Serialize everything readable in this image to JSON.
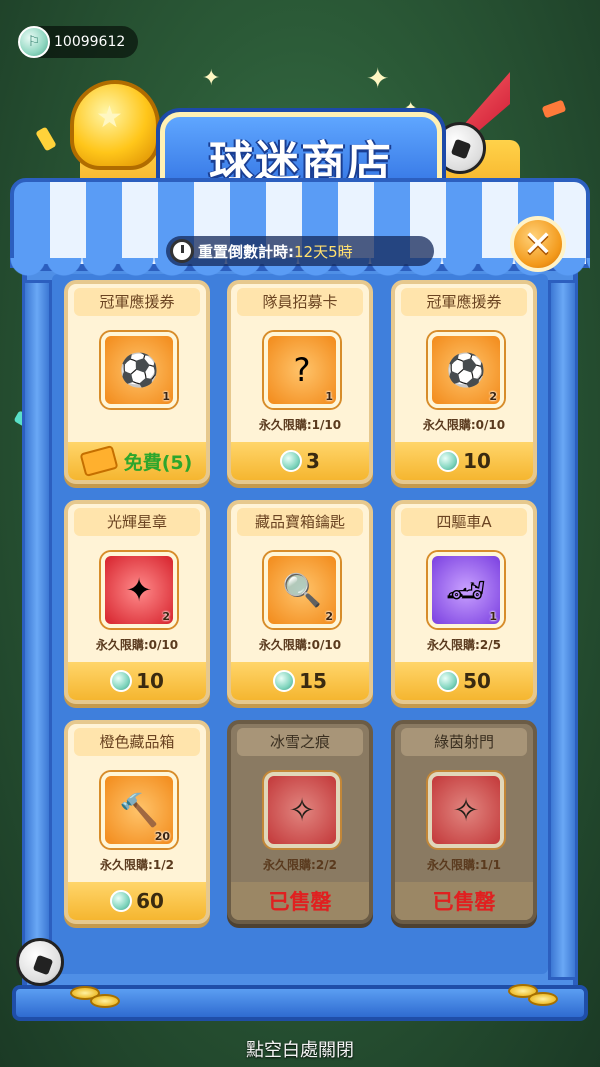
{
  "currency": {
    "amount": "10099612",
    "icon": "gem-coin-icon"
  },
  "title": "球迷商店",
  "timer": {
    "label": "重置倒數計時:",
    "value": "12天5時"
  },
  "close_glyph": "✕",
  "hint": "點空白處關閉",
  "items": [
    {
      "name": "冠軍應援券",
      "icon": "ticket-card-icon",
      "glyph": "⚽",
      "frame": "orange",
      "count": "1",
      "limit": "",
      "price": "免費(5)",
      "price_type": "free"
    },
    {
      "name": "隊員招募卡",
      "icon": "recruit-card-icon",
      "glyph": "?",
      "frame": "orange",
      "count": "1",
      "limit": "永久限購:1/10",
      "price": "3",
      "price_type": "gem"
    },
    {
      "name": "冠軍應援券",
      "icon": "ticket-card-icon",
      "glyph": "⚽",
      "frame": "orange",
      "count": "2",
      "limit": "永久限購:0/10",
      "price": "10",
      "price_type": "gem"
    },
    {
      "name": "光輝星章",
      "icon": "star-badge-icon",
      "glyph": "✦",
      "frame": "red",
      "count": "2",
      "limit": "永久限購:0/10",
      "price": "10",
      "price_type": "gem"
    },
    {
      "name": "藏品寶箱鑰匙",
      "icon": "magnifier-key-icon",
      "glyph": "🔍",
      "frame": "orange",
      "count": "2",
      "limit": "永久限購:0/10",
      "price": "15",
      "price_type": "gem"
    },
    {
      "name": "四驅車A",
      "icon": "race-car-icon",
      "glyph": "🏎",
      "frame": "purple",
      "count": "1",
      "limit": "永久限購:2/5",
      "price": "50",
      "price_type": "gem"
    },
    {
      "name": "橙色藏品箱",
      "icon": "collection-box-icon",
      "glyph": "🔨",
      "frame": "orange",
      "count": "20",
      "limit": "永久限購:1/2",
      "price": "60",
      "price_type": "gem"
    },
    {
      "name": "冰雪之痕",
      "icon": "ice-gun-icon",
      "glyph": "✧",
      "frame": "red",
      "count": "",
      "limit": "永久限購:2/2",
      "price": "已售罄",
      "price_type": "soldout"
    },
    {
      "name": "綠茵射門",
      "icon": "green-gun-icon",
      "glyph": "✧",
      "frame": "red",
      "count": "",
      "limit": "永久限購:1/1",
      "price": "已售罄",
      "price_type": "soldout"
    }
  ]
}
